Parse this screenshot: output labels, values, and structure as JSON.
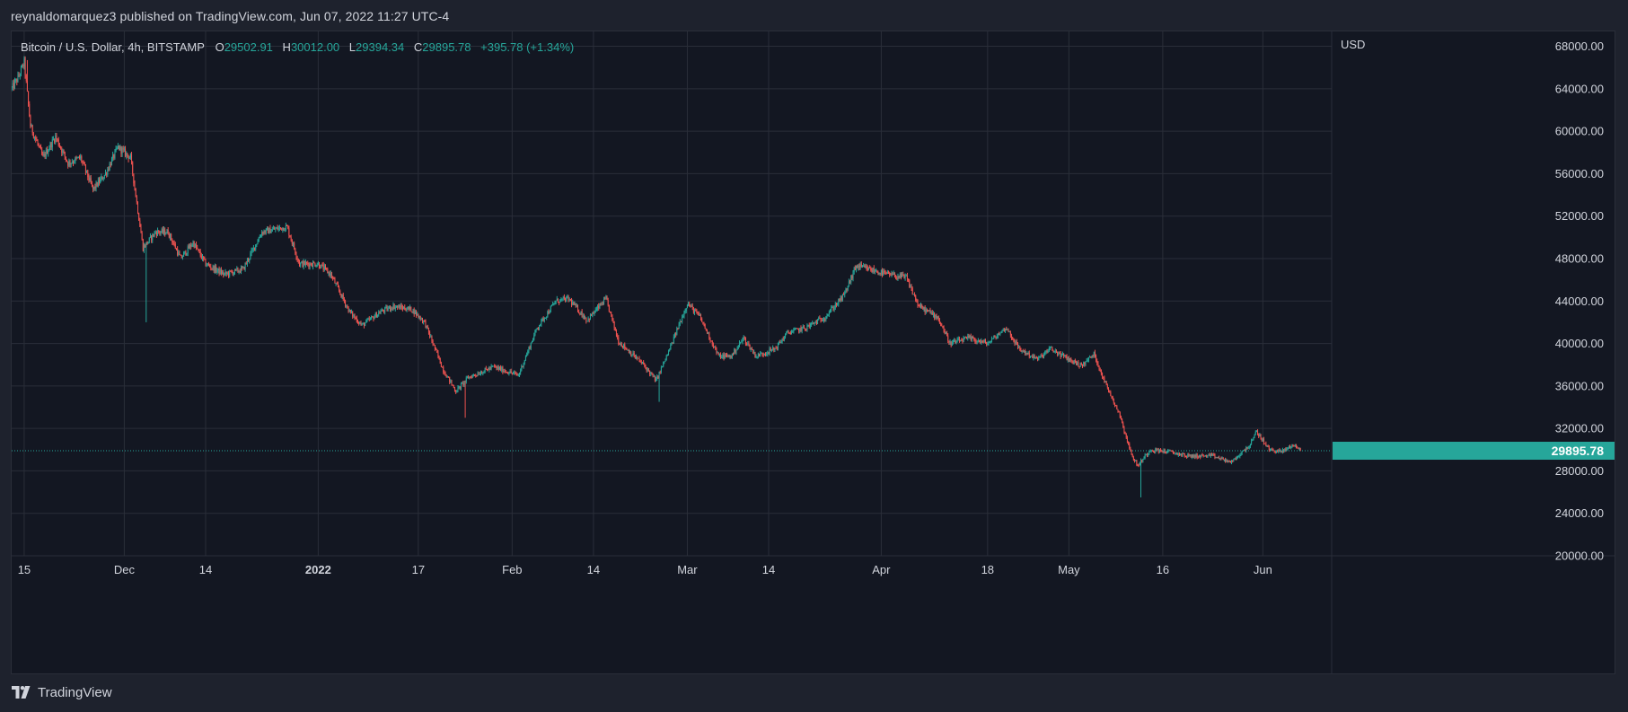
{
  "header": {
    "publisher_line": "reynaldomarquez3 published on TradingView.com, Jun 07, 2022 11:27 UTC-4"
  },
  "legend": {
    "symbol": "Bitcoin / U.S. Dollar, 4h, BITSTAMP",
    "open_label": "O",
    "open": "29502.91",
    "high_label": "H",
    "high": "30012.00",
    "low_label": "L",
    "low": "29394.34",
    "close_label": "C",
    "close": "29895.78",
    "change": "+395.78 (+1.34%)"
  },
  "footer": {
    "brand": "TradingView",
    "logo_icon": "tradingview-logo-icon"
  },
  "colors": {
    "up": "#26a69a",
    "down": "#ef5350",
    "background": "#131722",
    "grid": "#2a2e39",
    "text": "#d1d4dc",
    "last_price_badge": "#26a69a"
  },
  "chart_data": {
    "type": "candlestick",
    "symbol": "BTCUSD",
    "interval": "4h",
    "exchange": "BITSTAMP",
    "currency": "USD",
    "y_axis_label": "USD",
    "ylim": [
      20000,
      69400
    ],
    "y_ticks": [
      "68000.00",
      "64000.00",
      "60000.00",
      "56000.00",
      "52000.00",
      "48000.00",
      "44000.00",
      "40000.00",
      "36000.00",
      "32000.00",
      "28000.00",
      "24000.00",
      "20000.00"
    ],
    "x_ticks": [
      {
        "label": "15",
        "date": "2021-11-15",
        "bold": false
      },
      {
        "label": "Dec",
        "date": "2021-12-01",
        "bold": false
      },
      {
        "label": "14",
        "date": "2021-12-14",
        "bold": false
      },
      {
        "label": "2022",
        "date": "2022-01-01",
        "bold": true
      },
      {
        "label": "17",
        "date": "2022-01-17",
        "bold": false
      },
      {
        "label": "Feb",
        "date": "2022-02-01",
        "bold": false
      },
      {
        "label": "14",
        "date": "2022-02-14",
        "bold": false
      },
      {
        "label": "Mar",
        "date": "2022-03-01",
        "bold": false
      },
      {
        "label": "14",
        "date": "2022-03-14",
        "bold": false
      },
      {
        "label": "Apr",
        "date": "2022-04-01",
        "bold": false
      },
      {
        "label": "18",
        "date": "2022-04-18",
        "bold": false
      },
      {
        "label": "May",
        "date": "2022-05-01",
        "bold": false
      },
      {
        "label": "16",
        "date": "2022-05-16",
        "bold": false
      },
      {
        "label": "Jun",
        "date": "2022-06-01",
        "bold": false
      }
    ],
    "x_range": [
      "2021-11-13",
      "2022-06-12"
    ],
    "last_price": 29895.78,
    "last_price_label": "29895.78",
    "grid": true,
    "price_path": [
      [
        "2021-11-13",
        64000
      ],
      [
        "2021-11-14",
        65000
      ],
      [
        "2021-11-15",
        66500
      ],
      [
        "2021-11-16",
        60500
      ],
      [
        "2021-11-18",
        57500
      ],
      [
        "2021-11-20",
        59500
      ],
      [
        "2021-11-22",
        57000
      ],
      [
        "2021-11-24",
        57500
      ],
      [
        "2021-11-26",
        54500
      ],
      [
        "2021-11-28",
        56000
      ],
      [
        "2021-11-30",
        58500
      ],
      [
        "2021-12-02",
        57500
      ],
      [
        "2021-12-04",
        49000
      ],
      [
        "2021-12-06",
        50500
      ],
      [
        "2021-12-08",
        50500
      ],
      [
        "2021-12-10",
        48000
      ],
      [
        "2021-12-12",
        49500
      ],
      [
        "2021-12-14",
        47500
      ],
      [
        "2021-12-17",
        46500
      ],
      [
        "2021-12-20",
        47000
      ],
      [
        "2021-12-23",
        50500
      ],
      [
        "2021-12-27",
        51000
      ],
      [
        "2021-12-29",
        47500
      ],
      [
        "2022-01-01",
        47500
      ],
      [
        "2022-01-03",
        46500
      ],
      [
        "2022-01-06",
        43000
      ],
      [
        "2022-01-08",
        41700
      ],
      [
        "2022-01-11",
        43000
      ],
      [
        "2022-01-13",
        43500
      ],
      [
        "2022-01-16",
        43200
      ],
      [
        "2022-01-18",
        42000
      ],
      [
        "2022-01-21",
        37500
      ],
      [
        "2022-01-23",
        35500
      ],
      [
        "2022-01-25",
        36800
      ],
      [
        "2022-01-29",
        37800
      ],
      [
        "2022-02-02",
        37000
      ],
      [
        "2022-02-05",
        41500
      ],
      [
        "2022-02-08",
        44000
      ],
      [
        "2022-02-10",
        44200
      ],
      [
        "2022-02-13",
        42200
      ],
      [
        "2022-02-16",
        44200
      ],
      [
        "2022-02-18",
        40200
      ],
      [
        "2022-02-22",
        38000
      ],
      [
        "2022-02-24",
        36500
      ],
      [
        "2022-02-26",
        39200
      ],
      [
        "2022-03-01",
        43800
      ],
      [
        "2022-03-03",
        42500
      ],
      [
        "2022-03-06",
        38800
      ],
      [
        "2022-03-08",
        38800
      ],
      [
        "2022-03-10",
        40500
      ],
      [
        "2022-03-12",
        38800
      ],
      [
        "2022-03-15",
        39500
      ],
      [
        "2022-03-17",
        41000
      ],
      [
        "2022-03-20",
        41500
      ],
      [
        "2022-03-23",
        42500
      ],
      [
        "2022-03-26",
        44500
      ],
      [
        "2022-03-28",
        47300
      ],
      [
        "2022-03-30",
        47000
      ],
      [
        "2022-04-02",
        46500
      ],
      [
        "2022-04-05",
        46200
      ],
      [
        "2022-04-07",
        43500
      ],
      [
        "2022-04-10",
        42500
      ],
      [
        "2022-04-12",
        40000
      ],
      [
        "2022-04-15",
        40500
      ],
      [
        "2022-04-18",
        40000
      ],
      [
        "2022-04-21",
        41500
      ],
      [
        "2022-04-23",
        39500
      ],
      [
        "2022-04-26",
        38500
      ],
      [
        "2022-04-28",
        39500
      ],
      [
        "2022-05-01",
        38500
      ],
      [
        "2022-05-03",
        37900
      ],
      [
        "2022-05-05",
        39000
      ],
      [
        "2022-05-07",
        36000
      ],
      [
        "2022-05-09",
        33500
      ],
      [
        "2022-05-11",
        29500
      ],
      [
        "2022-05-12",
        28500
      ],
      [
        "2022-05-14",
        30000
      ],
      [
        "2022-05-17",
        29800
      ],
      [
        "2022-05-20",
        29400
      ],
      [
        "2022-05-24",
        29400
      ],
      [
        "2022-05-27",
        28800
      ],
      [
        "2022-05-30",
        30500
      ],
      [
        "2022-05-31",
        31700
      ],
      [
        "2022-06-02",
        30000
      ],
      [
        "2022-06-04",
        29800
      ],
      [
        "2022-06-06",
        30500
      ],
      [
        "2022-06-07",
        29895.78
      ]
    ],
    "spikes": [
      {
        "date": "2021-11-15",
        "high": 66700
      },
      {
        "date": "2021-12-04",
        "low": 42000
      },
      {
        "date": "2022-01-24",
        "low": 33000
      },
      {
        "date": "2022-02-24",
        "low": 34500
      },
      {
        "date": "2022-05-12",
        "low": 25500
      }
    ]
  }
}
